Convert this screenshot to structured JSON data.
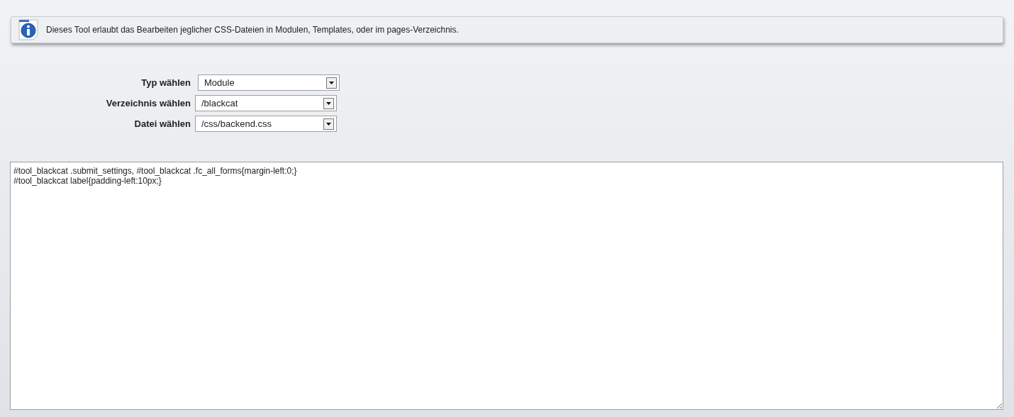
{
  "info_box": {
    "text": "Dieses Tool erlaubt das Bearbeiten jeglicher CSS-Dateien in Modulen, Templates, oder im pages-Verzeichnis."
  },
  "selects": [
    {
      "label": "Typ wählen",
      "value": "Module"
    },
    {
      "label": "Verzeichnis wählen",
      "value": "/blackcat"
    },
    {
      "label": "Datei wählen",
      "value": "/css/backend.css"
    }
  ],
  "editor": {
    "lines": [
      "#tool_blackcat .submit_settings, #tool_blackcat .fc_all_forms{margin-left:0;}",
      "#tool_blackcat label{padding-left:10px;}"
    ]
  }
}
